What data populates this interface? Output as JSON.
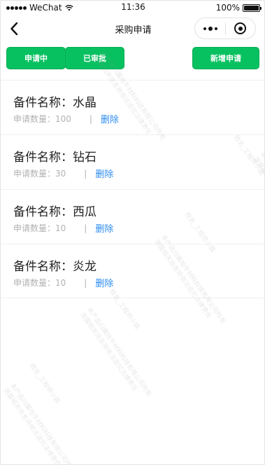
{
  "status_bar": {
    "carrier": "WeChat",
    "time": "11:36",
    "battery": "100%"
  },
  "nav": {
    "title": "采购申请"
  },
  "buttons": {
    "pending": "申请中",
    "approved": "已审批",
    "new_request": "新增申请"
  },
  "items": [
    {
      "label": "备件名称：",
      "name": "水晶",
      "qty_label": "申请数量：",
      "qty": "100",
      "separator": "|",
      "delete": "删除"
    },
    {
      "label": "备件名称：",
      "name": "钻石",
      "qty_label": "申请数量：",
      "qty": "30",
      "separator": "|",
      "delete": "删除"
    },
    {
      "label": "备件名称：",
      "name": "西瓜",
      "qty_label": "申请数量：",
      "qty": "10",
      "separator": "|",
      "delete": "删除"
    },
    {
      "label": "备件名称：",
      "name": "炎龙",
      "qty_label": "申请数量：",
      "qty": "10",
      "separator": "|",
      "delete": "删除"
    }
  ],
  "watermark": {
    "line1": "姓名_工程师小霖",
    "line2": "本产品归属哈牛材料科技有限公司所有",
    "line3": "泄露相关信息将依法追究法律责任"
  },
  "colors": {
    "accent": "#07c160",
    "link": "#2d8cf0",
    "muted": "#b2b2b2"
  }
}
